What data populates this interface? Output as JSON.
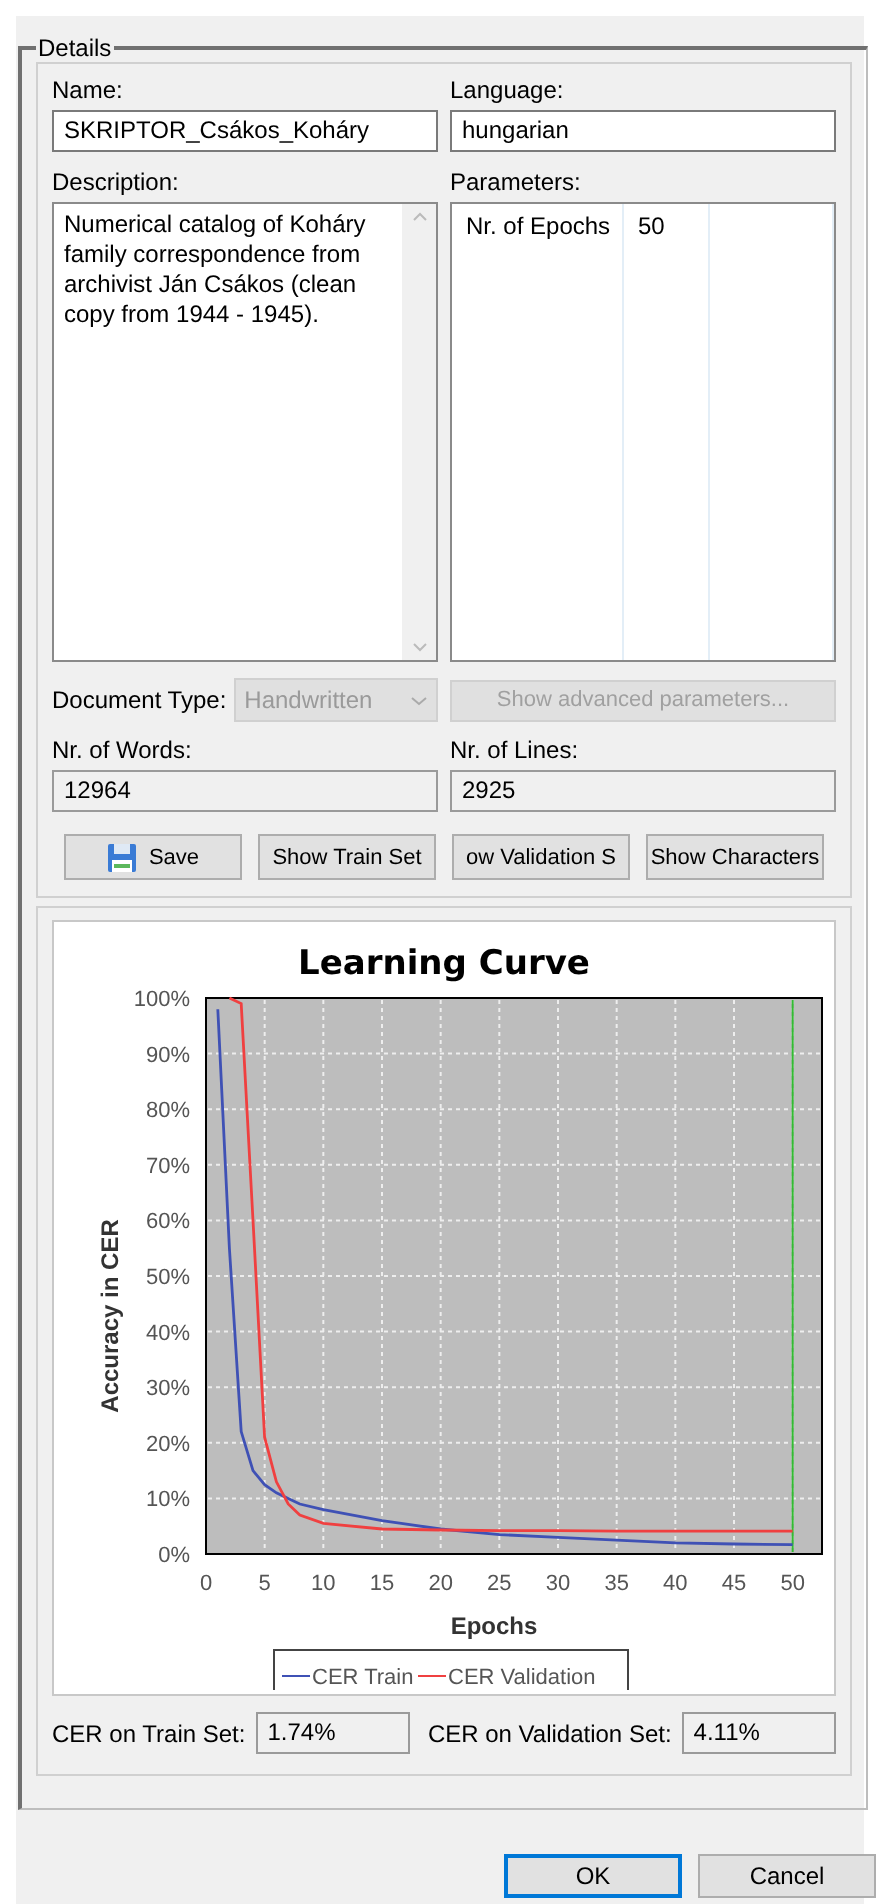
{
  "group_title": "Details",
  "fields": {
    "name_label": "Name:",
    "name_value": "SKRIPTOR_Csákos_Koháry",
    "language_label": "Language:",
    "language_value": "hungarian",
    "description_label": "Description:",
    "description_value": "Numerical catalog of Koháry family correspondence from archivist Ján Csákos (clean copy from 1944 - 1945).",
    "parameters_label": "Parameters:"
  },
  "parameters": [
    {
      "name": "Nr. of Epochs",
      "value": "50"
    }
  ],
  "document_type": {
    "label": "Document Type:",
    "value": "Handwritten",
    "disabled": true
  },
  "advanced_button": {
    "label": "Show advanced parameters...",
    "disabled": true
  },
  "counts": {
    "words_label": "Nr. of Words:",
    "words_value": "12964",
    "lines_label": "Nr. of Lines:",
    "lines_value": "2925"
  },
  "buttons": [
    {
      "label": "Save",
      "kind": "save"
    },
    {
      "label": "Show Train Set",
      "kind": "plain"
    },
    {
      "label": "ow Validation S",
      "kind": "plain"
    },
    {
      "label": "Show Characters",
      "kind": "plain"
    }
  ],
  "chart": {
    "chart_data": {
      "type": "line",
      "title": "Learning Curve",
      "xlabel": "Epochs",
      "ylabel": "Accuracy in CER",
      "x": [
        1,
        2,
        3,
        4,
        5,
        6,
        7,
        8,
        10,
        15,
        20,
        25,
        30,
        35,
        40,
        45,
        50
      ],
      "series": [
        {
          "name": "CER Train",
          "color": "#3f51b5",
          "values": [
            98,
            55,
            22,
            15,
            12.5,
            11,
            10,
            9,
            8,
            6,
            4.5,
            3.5,
            3,
            2.5,
            2,
            1.8,
            1.7
          ]
        },
        {
          "name": "CER Validation",
          "color": "#f04040",
          "values": [
            null,
            100,
            99,
            60,
            21,
            13,
            9,
            7,
            5.5,
            4.5,
            4.3,
            4.2,
            4.2,
            4.1,
            4.1,
            4.1,
            4.1
          ]
        }
      ],
      "xlim": [
        0,
        52.5
      ],
      "ylim": [
        0,
        100
      ],
      "xticks": [
        0,
        5,
        10,
        15,
        20,
        25,
        30,
        35,
        40,
        45,
        50
      ],
      "yticks": [
        {
          "value": 0,
          "label": "0%"
        },
        {
          "value": 10,
          "label": "10%"
        },
        {
          "value": 20,
          "label": "20%"
        },
        {
          "value": 30,
          "label": "30%"
        },
        {
          "value": 40,
          "label": "40%"
        },
        {
          "value": 50,
          "label": "50%"
        },
        {
          "value": 60,
          "label": "60%"
        },
        {
          "value": 70,
          "label": "70%"
        },
        {
          "value": 80,
          "label": "80%"
        },
        {
          "value": 90,
          "label": "90%"
        },
        {
          "value": 100,
          "label": "100%"
        }
      ],
      "grid": true,
      "legend": true,
      "ref_lines": [
        {
          "axis": "x",
          "value": 50,
          "color": "#33bb33"
        }
      ]
    }
  },
  "results": [
    {
      "label": "CER on Train Set:",
      "value": "1.74%"
    },
    {
      "label": "CER on Validation Set:",
      "value": "4.11%"
    }
  ],
  "dialog_buttons": [
    {
      "label": "OK",
      "selected": true
    },
    {
      "label": "Cancel",
      "selected": false
    }
  ]
}
